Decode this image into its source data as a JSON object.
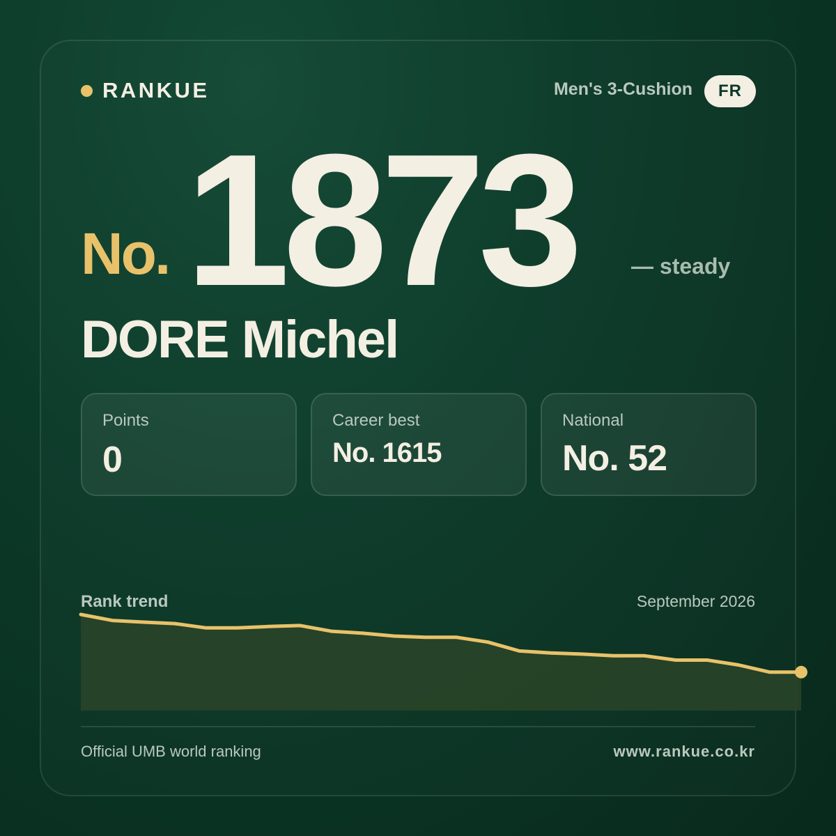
{
  "brand": {
    "name": "RANKUE",
    "accent_color": "#e8c26a"
  },
  "header": {
    "category": "Men's 3-Cushion",
    "country_code": "FR"
  },
  "rank": {
    "prefix": "No.",
    "number": "1873",
    "change": "— steady"
  },
  "player": {
    "name": "DORE Michel"
  },
  "stats": [
    {
      "label": "Points",
      "value": "0"
    },
    {
      "label": "Career best",
      "value": "No. 1615"
    },
    {
      "label": "National",
      "value": "No. 52"
    }
  ],
  "trend": {
    "label": "Rank trend",
    "date": "September 2026",
    "line_color": "#e8c26a",
    "fill_color": "#2a4428"
  },
  "chart_data": {
    "type": "area",
    "title": "Rank trend",
    "values": [
      1000,
      975,
      968,
      962,
      944,
      944,
      950,
      954,
      930,
      922,
      910,
      905,
      905,
      885,
      848,
      840,
      835,
      828,
      828,
      810,
      810,
      790,
      760,
      760
    ],
    "ylim": [
      600,
      1000
    ],
    "grid": false
  },
  "footer": {
    "source": "Official UMB world ranking",
    "url": "www.rankue.co.kr"
  }
}
